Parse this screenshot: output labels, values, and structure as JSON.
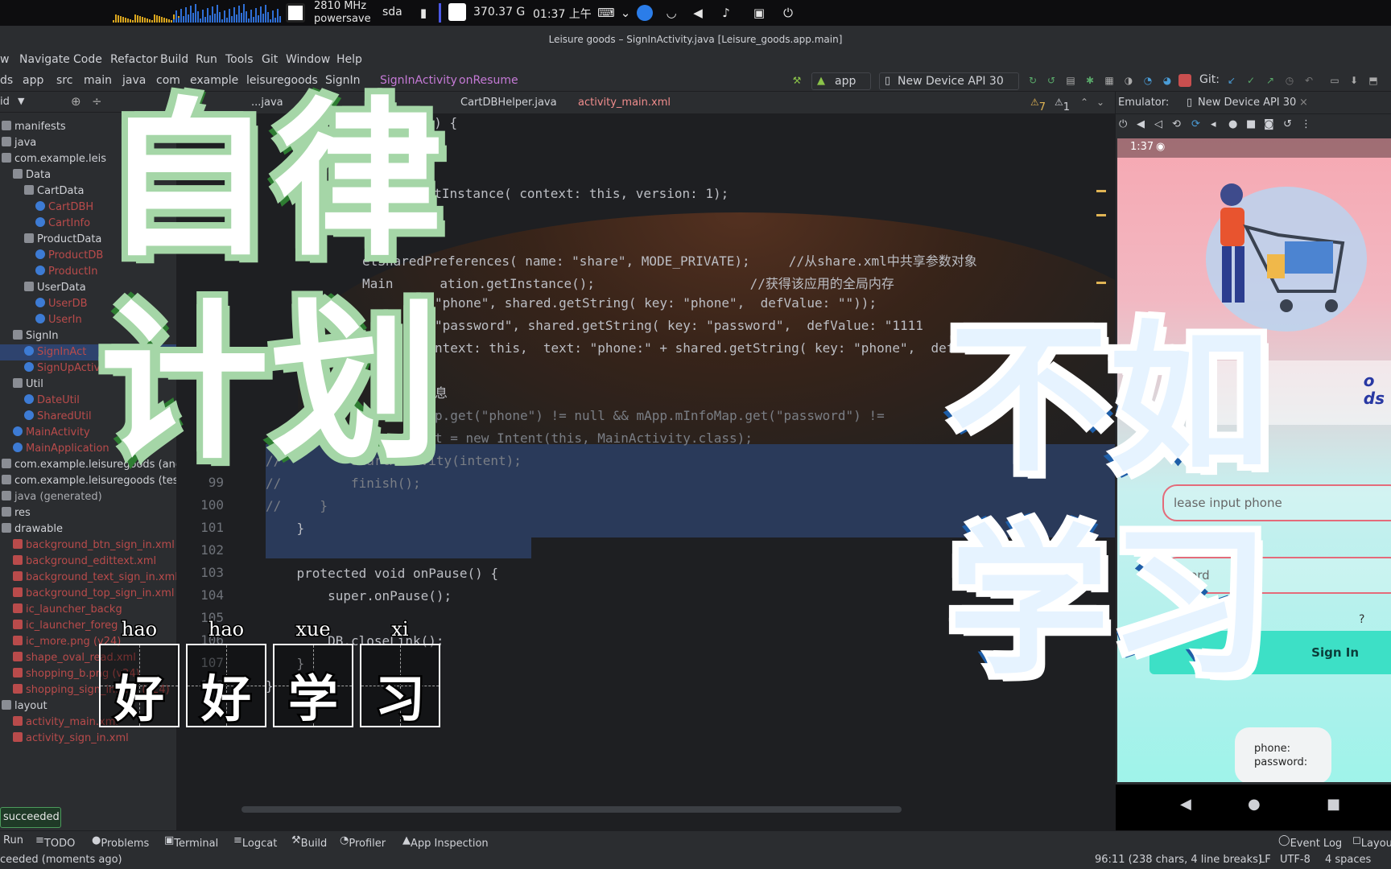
{
  "system_bar": {
    "cpu_freq": "2810 MHz",
    "cpu_mode": "powersave",
    "disk": "sda",
    "storage": "370.37 G",
    "clock": "01:37 上午"
  },
  "window": {
    "title": "Leisure goods – SignInActivity.java [Leisure_goods.app.main]"
  },
  "menu": [
    "w",
    "Navigate",
    "Code",
    "Refactor",
    "Build",
    "Run",
    "Tools",
    "Git",
    "Window",
    "Help"
  ],
  "breadcrumb": [
    "ds",
    "app",
    "src",
    "main",
    "java",
    "com",
    "example",
    "leisuregoods",
    "SignIn",
    "SignInActivity",
    "onResume"
  ],
  "toolbar": {
    "run_config": "app",
    "device": "New Device API 30",
    "git_label": "Git:"
  },
  "project_panel": {
    "header": "id",
    "items": [
      {
        "label": "manifests",
        "indent": 0,
        "icon": "folder-icon",
        "color": "#cfd1d6"
      },
      {
        "label": "java",
        "indent": 0,
        "icon": "folder-icon",
        "color": "#cfd1d6"
      },
      {
        "label": "com.example.leis",
        "indent": 0,
        "icon": "folder-icon",
        "color": "#cfd1d6"
      },
      {
        "label": "Data",
        "indent": 1,
        "icon": "folder-icon",
        "color": "#cfd1d6"
      },
      {
        "label": "CartData",
        "indent": 2,
        "icon": "folder-icon",
        "color": "#cfd1d6"
      },
      {
        "label": "CartDBH",
        "indent": 3,
        "icon": "class-icon",
        "color": "#b94b4b"
      },
      {
        "label": "CartInfo",
        "indent": 3,
        "icon": "class-icon",
        "color": "#b94b4b"
      },
      {
        "label": "ProductData",
        "indent": 2,
        "icon": "folder-icon",
        "color": "#cfd1d6"
      },
      {
        "label": "ProductDB",
        "indent": 3,
        "icon": "class-icon",
        "color": "#b94b4b"
      },
      {
        "label": "ProductIn",
        "indent": 3,
        "icon": "class-icon",
        "color": "#b94b4b"
      },
      {
        "label": "UserData",
        "indent": 2,
        "icon": "folder-icon",
        "color": "#cfd1d6"
      },
      {
        "label": "UserDB",
        "indent": 3,
        "icon": "class-icon",
        "color": "#b94b4b"
      },
      {
        "label": "UserIn",
        "indent": 3,
        "icon": "class-icon",
        "color": "#b94b4b"
      },
      {
        "label": "SignIn",
        "indent": 1,
        "icon": "folder-icon",
        "color": "#cfd1d6"
      },
      {
        "label": "SignInAct",
        "indent": 2,
        "icon": "class-icon",
        "color": "#b94b4b"
      },
      {
        "label": "SignUpActivity",
        "indent": 2,
        "icon": "class-icon",
        "color": "#b94b4b"
      },
      {
        "label": "Util",
        "indent": 1,
        "icon": "folder-icon",
        "color": "#cfd1d6"
      },
      {
        "label": "DateUtil",
        "indent": 2,
        "icon": "class-icon",
        "color": "#b94b4b"
      },
      {
        "label": "SharedUtil",
        "indent": 2,
        "icon": "class-icon",
        "color": "#b94b4b"
      },
      {
        "label": "MainActivity",
        "indent": 1,
        "icon": "class-icon",
        "color": "#b94b4b"
      },
      {
        "label": "MainApplication",
        "indent": 1,
        "icon": "class-icon",
        "color": "#b94b4b"
      },
      {
        "label": "com.example.leisuregoods (andro",
        "indent": 0,
        "icon": "folder-icon",
        "color": "#cfd1d6"
      },
      {
        "label": "com.example.leisuregoods (test)",
        "indent": 0,
        "icon": "folder-icon",
        "color": "#cfd1d6"
      },
      {
        "label": "java (generated)",
        "indent": 0,
        "icon": "folder-icon",
        "color": "#a9abb0"
      },
      {
        "label": "res",
        "indent": 0,
        "icon": "folder-icon",
        "color": "#cfd1d6"
      },
      {
        "label": "drawable",
        "indent": 0,
        "icon": "folder-icon",
        "color": "#cfd1d6"
      },
      {
        "label": "background_btn_sign_in.xml",
        "indent": 1,
        "icon": "xml-icon",
        "color": "#b94b4b"
      },
      {
        "label": "background_edittext.xml",
        "indent": 1,
        "icon": "xml-icon",
        "color": "#b94b4b"
      },
      {
        "label": "background_text_sign_in.xml",
        "indent": 1,
        "icon": "xml-icon",
        "color": "#b94b4b"
      },
      {
        "label": "background_top_sign_in.xml",
        "indent": 1,
        "icon": "xml-icon",
        "color": "#b94b4b"
      },
      {
        "label": "ic_launcher_backg",
        "indent": 1,
        "icon": "xml-icon",
        "color": "#b94b4b"
      },
      {
        "label": "ic_launcher_foreg",
        "indent": 1,
        "icon": "xml-icon",
        "color": "#b94b4b"
      },
      {
        "label": "ic_more.png (v24)",
        "indent": 1,
        "icon": "xml-icon",
        "color": "#b94b4b"
      },
      {
        "label": "shape_oval_read.xml",
        "indent": 1,
        "icon": "xml-icon",
        "color": "#b94b4b"
      },
      {
        "label": "shopping_b.png (v24)",
        "indent": 1,
        "icon": "xml-icon",
        "color": "#b94b4b"
      },
      {
        "label": "shopping_sign_in.png (v24)",
        "indent": 1,
        "icon": "xml-icon",
        "color": "#b94b4b"
      },
      {
        "label": "layout",
        "indent": 0,
        "icon": "folder-icon",
        "color": "#cfd1d6"
      },
      {
        "label": "activity_main.xml",
        "indent": 1,
        "icon": "xml-icon",
        "color": "#b94b4b"
      },
      {
        "label": "activity_sign_in.xml",
        "indent": 1,
        "icon": "xml-icon",
        "color": "#b94b4b"
      }
    ]
  },
  "editor_tabs": [
    "...java",
    "CartDBHelper.java",
    "activity_main.xml"
  ],
  "inspection": {
    "warnings": "7",
    "weak_warnings": "1"
  },
  "code": [
    {
      "ln": "",
      "text": "e() {"
    },
    {
      "ln": "",
      "text": "getInstance( context: this, version: 1);"
    },
    {
      "ln": "",
      "text": "etSharedPreferences( name: \"share\", MODE_PRIVATE);     //从share.xml中共享参数对象"
    },
    {
      "ln": "",
      "text": "Main      ation.getInstance();                    //获得该应用的全局内存"
    },
    {
      "ln": "",
      "text": "\"phone\", shared.getString( key: \"phone\",  defValue: \"\"));"
    },
    {
      "ln": "",
      "text": "\"password\", shared.getString( key: \"password\",  defValue: \"1111"
    },
    {
      "ln": "",
      "text": "ntext: this,  text: \"phone:\" + shared.getString( key: \"phone\",  defValue: \""
    },
    {
      "ln": "",
      "text": "息"
    },
    {
      "ln": "",
      "text": "p.get(\"phone\") != null && mApp.mInfoMap.get(\"password\") !="
    },
    {
      "ln": "",
      "text": "t = new Intent(this, MainActivity.class);"
    },
    {
      "ln": "98",
      "text": "//         startActivity(intent);"
    },
    {
      "ln": "99",
      "text": "//         finish();"
    },
    {
      "ln": "100",
      "text": "//     }"
    },
    {
      "ln": "101",
      "text": "    }"
    },
    {
      "ln": "102",
      "text": ""
    },
    {
      "ln": "103",
      "text": "    protected void onPause() {"
    },
    {
      "ln": "104",
      "text": "        super.onPause();"
    },
    {
      "ln": "105",
      "text": ""
    },
    {
      "ln": "106",
      "text": "        DB.closeLink();"
    },
    {
      "ln": "107",
      "text": "    }"
    },
    {
      "ln": "108",
      "text": "}"
    }
  ],
  "emulator": {
    "tab_label": "Emulator:",
    "device_tab": "New Device API 30",
    "phone_time": "1:37",
    "title_partial": "o\nds",
    "phone_placeholder": "lease input phone",
    "password_placeholder": "sword",
    "forgot_partial": "?",
    "sign_in_label": "Sign In",
    "info_phone": "phone:",
    "info_password": "password:"
  },
  "bottom_tools": [
    "Run",
    "TODO",
    "Problems",
    "Terminal",
    "Logcat",
    "Build",
    "Profiler",
    "App Inspection"
  ],
  "bottom_right": [
    "Event Log",
    "Layout"
  ],
  "status": {
    "left": "ceeded (moments ago)",
    "popup": "succeeded",
    "position": "96:11 (238 chars, 4 line breaks)",
    "line_sep": "LF",
    "encoding": "UTF-8",
    "indent": "4 spaces"
  },
  "overlay": {
    "left_line1": "自律",
    "left_line2": "计划",
    "right_line1": "不如",
    "right_line2": "学习",
    "cards": [
      {
        "pinyin": "hao",
        "hanzi": "好"
      },
      {
        "pinyin": "hao",
        "hanzi": "好"
      },
      {
        "pinyin": "xue",
        "hanzi": "学"
      },
      {
        "pinyin": "xi",
        "hanzi": "习"
      }
    ]
  },
  "colors": {
    "ide_bg": "#1e1f22",
    "panel_bg": "#2b2d30",
    "accent_green": "#2e7d32",
    "accent_blue": "#1e5ea8",
    "error_red": "#b94b4b"
  }
}
